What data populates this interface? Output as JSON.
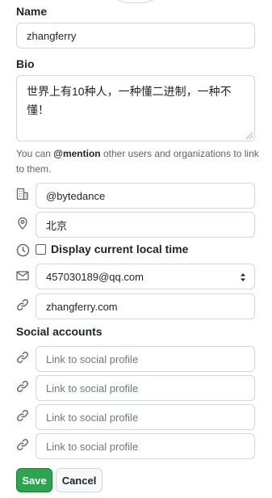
{
  "name": {
    "label": "Name",
    "value": "zhangferry"
  },
  "bio": {
    "label": "Bio",
    "value": "世界上有10种人，一种懂二进制，一种不懂！",
    "hint_prefix": "You can ",
    "hint_mention": "@mention",
    "hint_suffix": " other users and organizations to link to them."
  },
  "company": {
    "icon": "building-icon",
    "value": "@bytedance"
  },
  "location": {
    "icon": "location-pin-icon",
    "value": "北京"
  },
  "local_time": {
    "icon": "clock-icon",
    "label": "Display current local time",
    "checked": false
  },
  "email": {
    "icon": "mail-icon",
    "selected": "457030189@qq.com"
  },
  "website": {
    "icon": "link-icon",
    "value": "zhangferry.com"
  },
  "social": {
    "label": "Social accounts",
    "placeholders": [
      "Link to social profile",
      "Link to social profile",
      "Link to social profile",
      "Link to social profile"
    ]
  },
  "actions": {
    "save_label": "Save",
    "cancel_label": "Cancel"
  },
  "colors": {
    "save_bg": "#2da44e",
    "border": "#d0d7de",
    "muted_text": "#59636e",
    "icon": "#59636e"
  }
}
